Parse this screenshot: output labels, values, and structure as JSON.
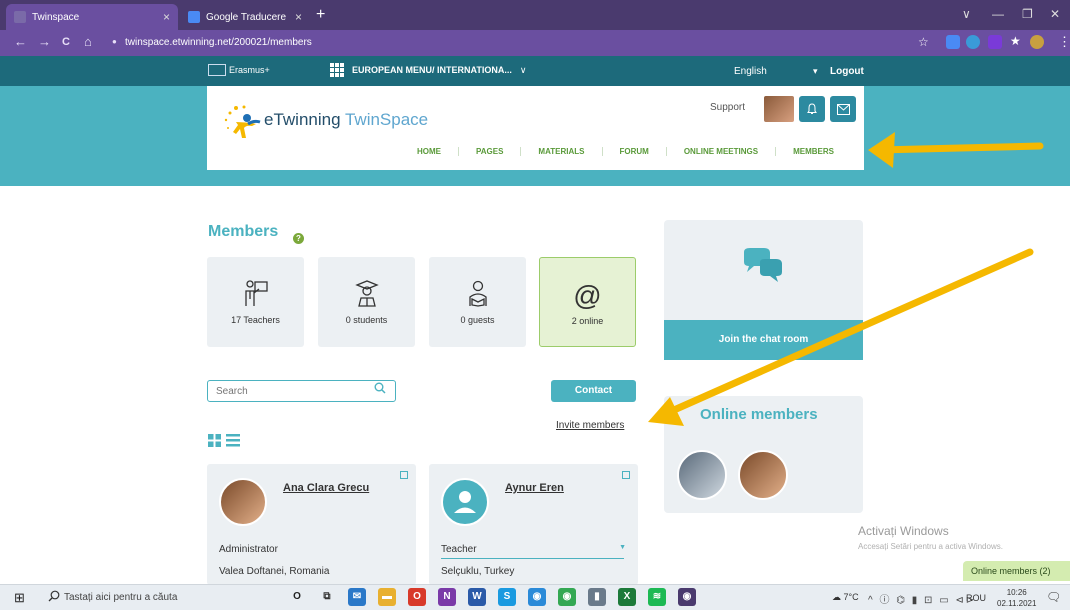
{
  "browser": {
    "tabs": [
      {
        "label": "Twinspace",
        "close": "×",
        "icon_color": "#7a6aa8"
      },
      {
        "label": "Google Traducere",
        "close": "×",
        "icon_color": "#4a8af4"
      }
    ],
    "new_tab": "+",
    "window_controls": {
      "chevron": "∨",
      "minimize": "—",
      "restore": "❐",
      "close": "✕"
    },
    "nav": {
      "back": "←",
      "forward": "→",
      "reload": "C",
      "home": "⌂"
    },
    "url": "twinspace.etwinning.net/200021/members",
    "lock": "🔒",
    "extensions": [
      {
        "name": "star-icon",
        "glyph": "☆",
        "color": "#4a3a6e"
      },
      {
        "name": "translate-extension-icon",
        "color": "#4a8af4"
      },
      {
        "name": "extension-icon-2",
        "color": "#3a9ad8"
      },
      {
        "name": "extension-icon-3",
        "color": "#7a3ad8"
      },
      {
        "name": "puzzle-icon",
        "glyph": "★",
        "color": "#4a3a6e"
      },
      {
        "name": "profile-avatar",
        "color": "#c8a040"
      }
    ],
    "menu": "⋮"
  },
  "site": {
    "erasmus": "Erasmus+",
    "eu_menu": "EUROPEAN MENU/ INTERNATIONA...",
    "eu_caret": "∨",
    "language": "English",
    "language_caret": "▾",
    "logout": "Logout",
    "logo_e": "eTwinning ",
    "logo_twinspace": "TwinSpace",
    "support": "Support",
    "bell": "🔔",
    "mail": "✉",
    "nav": [
      "HOME",
      "PAGES",
      "MATERIALS",
      "FORUM",
      "ONLINE MEETINGS",
      "MEMBERS"
    ]
  },
  "members": {
    "title": "Members",
    "help": "?",
    "stats": [
      {
        "label": "17 Teachers",
        "icon": "teacher-icon",
        "glyph": "👨‍🏫"
      },
      {
        "label": "0 students",
        "icon": "student-icon",
        "glyph": "🎓"
      },
      {
        "label": "0 guests",
        "icon": "guest-icon",
        "glyph": "👤"
      },
      {
        "label": "2 online",
        "icon": "at-icon",
        "glyph": "@"
      }
    ],
    "search_placeholder": "Search",
    "search_icon": "⚲",
    "contact": "Contact",
    "invite": "Invite members",
    "view_grid": "▦",
    "view_list": "☰",
    "cards": [
      {
        "name": "Ana Clara Grecu",
        "role": "Administrator",
        "location": "Valea Doftanei, Romania"
      },
      {
        "name": "Aynur Eren",
        "role": "Teacher",
        "location": "Selçuklu, Turkey",
        "dropdown": "▼"
      }
    ]
  },
  "chat": {
    "join": "Join the chat room"
  },
  "online": {
    "title": "Online members"
  },
  "windows": {
    "activate_title": "Activați Windows",
    "activate_sub": "Accesați Setări pentru a activa Windows.",
    "online_tab": "Online members (2)"
  },
  "taskbar": {
    "start": "⊞",
    "search_icon": "⚲",
    "search_placeholder": "Tastați aici pentru a căuta",
    "apps": [
      {
        "name": "cortana-icon",
        "glyph": "O",
        "color": "transparent",
        "text": "#222"
      },
      {
        "name": "task-view-icon",
        "glyph": "⧉",
        "color": "transparent",
        "text": "#333"
      },
      {
        "name": "mail-app-icon",
        "glyph": "✉",
        "color": "#2a78c8",
        "text": "#fff"
      },
      {
        "name": "file-explorer-icon",
        "glyph": "▬",
        "color": "#e8b030",
        "text": "#fff"
      },
      {
        "name": "office-icon",
        "glyph": "O",
        "color": "#d83a2a",
        "text": "#fff"
      },
      {
        "name": "onenote-icon",
        "glyph": "N",
        "color": "#7a3aa8",
        "text": "#fff"
      },
      {
        "name": "word-icon",
        "glyph": "W",
        "color": "#2a5aa8",
        "text": "#fff"
      },
      {
        "name": "skype-icon",
        "glyph": "S",
        "color": "#1a9ae0",
        "text": "#fff"
      },
      {
        "name": "chrome-blue-icon",
        "glyph": "◉",
        "color": "#2a8ad8",
        "text": "#fff"
      },
      {
        "name": "chrome-icon",
        "glyph": "◉",
        "color": "#34a853",
        "text": "#fff"
      },
      {
        "name": "phone-icon",
        "glyph": "▮",
        "color": "#6a7a8a",
        "text": "#fff"
      },
      {
        "name": "excel-icon",
        "glyph": "X",
        "color": "#1d7a3a",
        "text": "#fff"
      },
      {
        "name": "spotify-icon",
        "glyph": "≋",
        "color": "#1db954",
        "text": "#fff"
      },
      {
        "name": "chrome-profile-icon",
        "glyph": "◉",
        "color": "#4a3a6e",
        "text": "#fff"
      }
    ],
    "weather": "☁ 7°C",
    "tray": "^ ⓘ ⌬ ▮ ⊡ ▭ ⊲⊳",
    "lang": "ROU",
    "time": "10:26",
    "date": "02.11.2021",
    "notif": "🗨"
  }
}
